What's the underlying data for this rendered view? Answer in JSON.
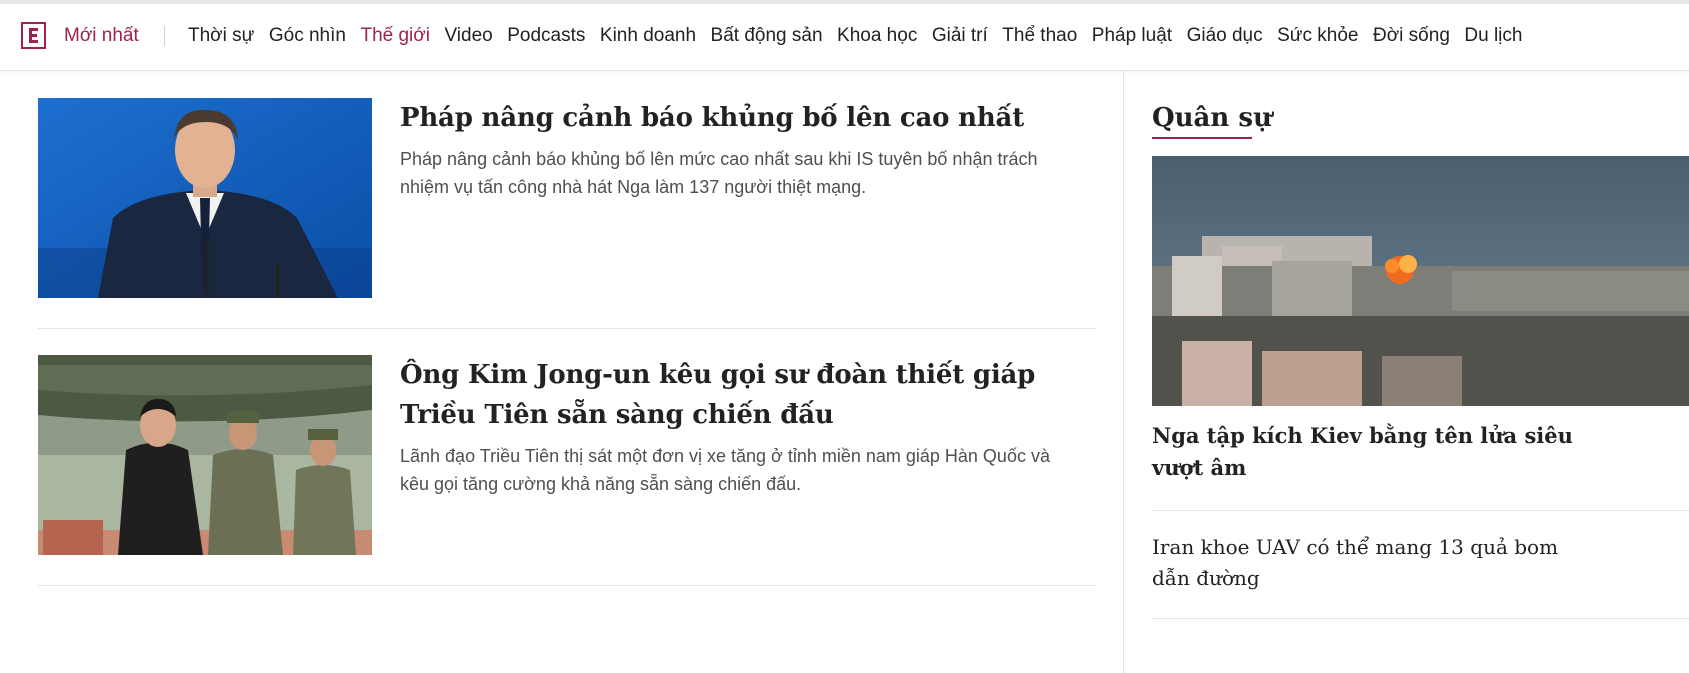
{
  "nav": {
    "latest_label": "Mới nhất",
    "items": [
      "Thời sự",
      "Góc nhìn",
      "Thế giới",
      "Video",
      "Podcasts",
      "Kinh doanh",
      "Bất động sản",
      "Khoa học",
      "Giải trí",
      "Thể thao",
      "Pháp luật",
      "Giáo dục",
      "Sức khỏe",
      "Đời sống",
      "Du lịch"
    ],
    "active_item": "Thế giới"
  },
  "articles": [
    {
      "title": "Pháp nâng cảnh báo khủng bố lên cao nhất",
      "description": "Pháp nâng cảnh báo khủng bố lên mức cao nhất sau khi IS tuyên bố nhận trách nhiệm vụ tấn công nhà hát Nga làm 137 người thiệt mạng."
    },
    {
      "title": "Ông Kim Jong-un kêu gọi sư đoàn thiết giáp Triều Tiên sẵn sàng chiến đấu",
      "description": "Lãnh đạo Triều Tiên thị sát một đơn vị xe tăng ở tỉnh miền nam giáp Hàn Quốc và kêu gọi tăng cường khả năng sẵn sàng chiến đấu."
    }
  ],
  "sidebar": {
    "heading": "Quân sự",
    "featured_title": "Nga tập kích Kiev bằng tên lửa siêu vượt âm",
    "second_title": "Iran khoe UAV có thể mang 13 quả bom dẫn đường"
  },
  "colors": {
    "brand": "#9f224e",
    "text": "#222222",
    "muted": "#4f4f4f",
    "divider": "#e5e5e5"
  }
}
